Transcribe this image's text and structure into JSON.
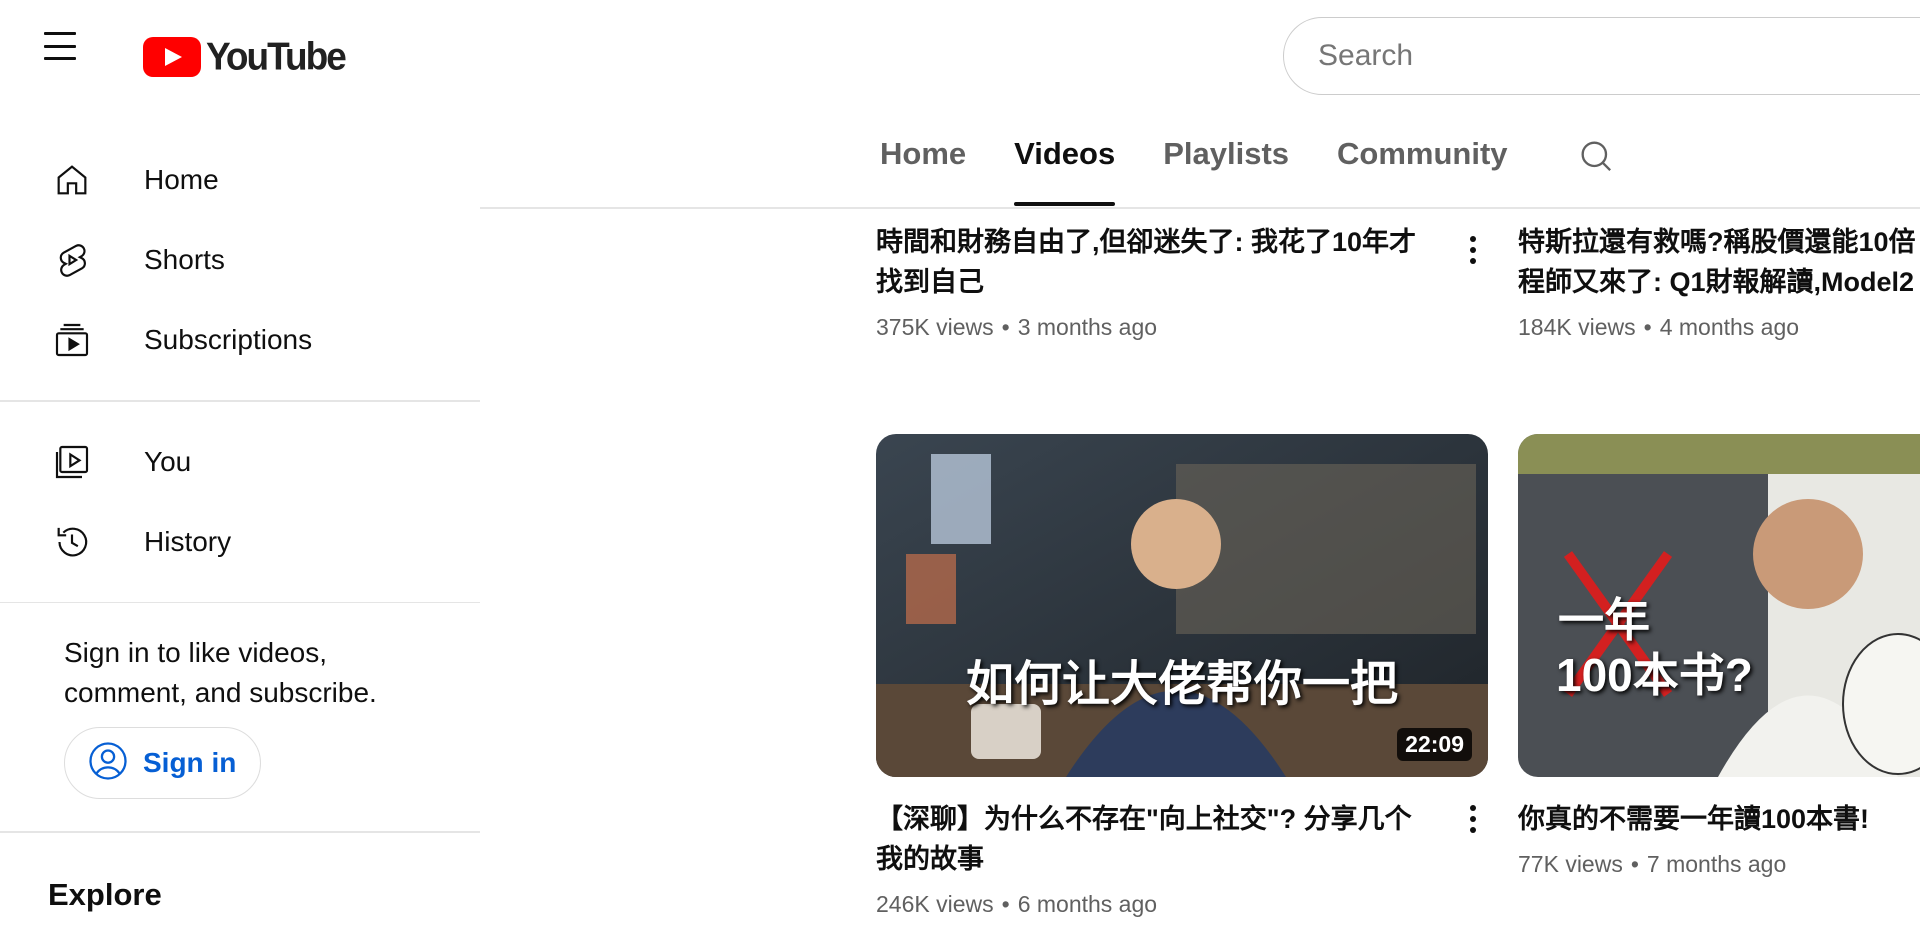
{
  "header": {
    "logo_text": "YouTube",
    "search_placeholder": "Search"
  },
  "sidebar": {
    "items": [
      {
        "label": "Home",
        "icon": "home-icon"
      },
      {
        "label": "Shorts",
        "icon": "shorts-icon"
      },
      {
        "label": "Subscriptions",
        "icon": "subscriptions-icon"
      }
    ],
    "you_items": [
      {
        "label": "You",
        "icon": "your-channel-icon"
      },
      {
        "label": "History",
        "icon": "history-icon"
      }
    ],
    "signin_prompt": "Sign in to like videos, comment, and subscribe.",
    "signin_button": "Sign in",
    "explore_title": "Explore"
  },
  "tabs": [
    {
      "label": "Home",
      "active": false
    },
    {
      "label": "Videos",
      "active": true
    },
    {
      "label": "Playlists",
      "active": false
    },
    {
      "label": "Community",
      "active": false
    }
  ],
  "videos": [
    {
      "title": "時間和財務自由了,但卻迷失了: 我花了10年才找到自己",
      "views": "375K views",
      "age": "3 months ago"
    },
    {
      "title": "特斯拉還有救嗎?稱股價還能10倍 程師又來了: Q1財報解讀,Model2",
      "views": "184K views",
      "age": "4 months ago"
    },
    {
      "title": "【深聊】为什么不存在\"向上社交\"? 分享几个我的故事",
      "views": "246K views",
      "age": "6 months ago",
      "duration": "22:09",
      "thumb_caption": "如何让大佬帮你一把"
    },
    {
      "title": "你真的不需要一年讀100本書!",
      "views": "77K views",
      "age": "7 months ago",
      "thumb_caption_top": "一年",
      "thumb_caption_bottom": "100本书?"
    }
  ],
  "meta_separator": "•"
}
